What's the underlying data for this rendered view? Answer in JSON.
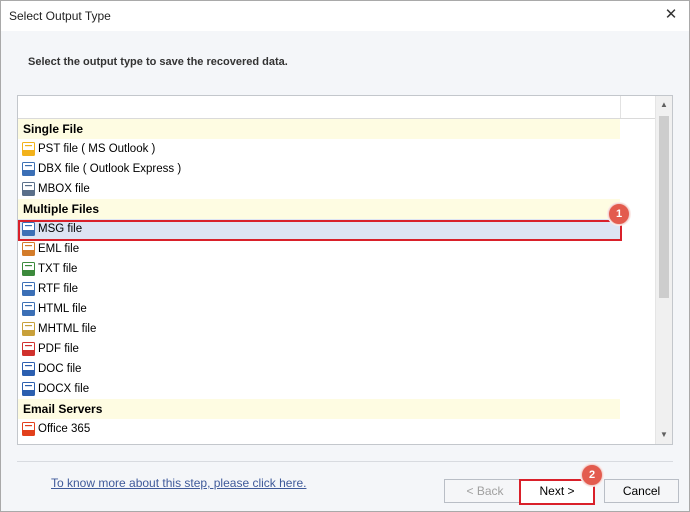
{
  "window": {
    "title": "Select Output Type"
  },
  "instruction": "Select the output type to save the recovered data.",
  "groups": [
    {
      "label": "Single File",
      "items": [
        {
          "label": "PST file ( MS Outlook )",
          "icon": "pst-icon",
          "color": "#f2b21b"
        },
        {
          "label": "DBX file ( Outlook Express )",
          "icon": "dbx-icon",
          "color": "#3b6fb6"
        },
        {
          "label": "MBOX file",
          "icon": "mbox-icon",
          "color": "#5a6f8a"
        }
      ]
    },
    {
      "label": "Multiple Files",
      "items": [
        {
          "label": "MSG file",
          "icon": "msg-icon",
          "color": "#3b6fb6",
          "selected": true
        },
        {
          "label": "EML file",
          "icon": "eml-icon",
          "color": "#d37c2a"
        },
        {
          "label": "TXT file",
          "icon": "txt-icon",
          "color": "#3c8a3c"
        },
        {
          "label": "RTF file",
          "icon": "rtf-icon",
          "color": "#3b6fb6"
        },
        {
          "label": "HTML file",
          "icon": "html-icon",
          "color": "#3b6fb6"
        },
        {
          "label": "MHTML file",
          "icon": "mhtml-icon",
          "color": "#c8a03a"
        },
        {
          "label": "PDF file",
          "icon": "pdf-icon",
          "color": "#d0312d"
        },
        {
          "label": "DOC file",
          "icon": "doc-icon",
          "color": "#2b5fb0"
        },
        {
          "label": "DOCX file",
          "icon": "docx-icon",
          "color": "#2b5fb0"
        }
      ]
    },
    {
      "label": "Email Servers",
      "items": [
        {
          "label": "Office 365",
          "icon": "office365-icon",
          "color": "#e2401c"
        }
      ]
    }
  ],
  "badges": {
    "step1": "1",
    "step2": "2"
  },
  "footer": {
    "help_link": "To know more about this step, please click here.",
    "back_label": "< Back",
    "next_label": "Next >",
    "cancel_label": "Cancel"
  },
  "colors": {
    "highlight_border": "#d9202a",
    "group_bg": "#fefce2",
    "badge": "#e35b4e"
  }
}
